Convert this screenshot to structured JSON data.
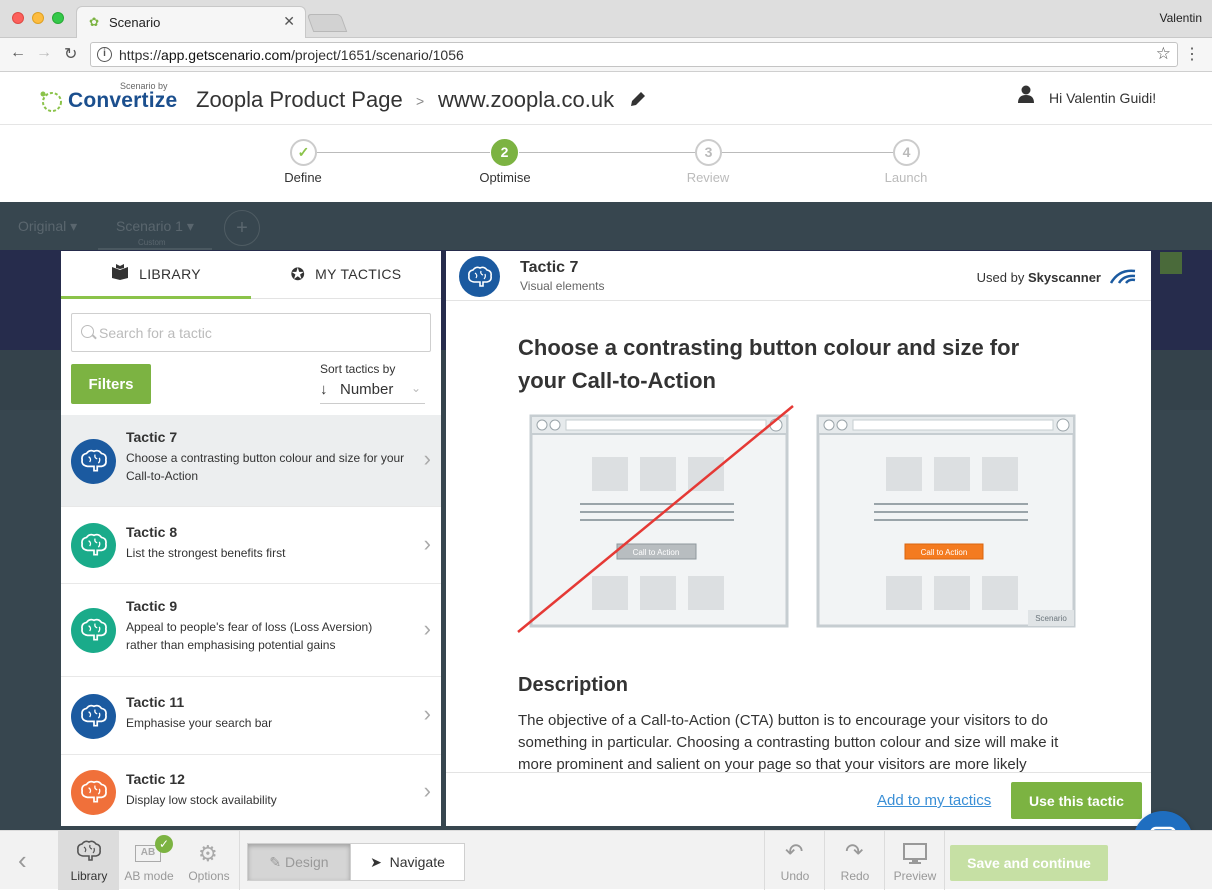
{
  "browser": {
    "tab_title": "Scenario",
    "profile_name": "Valentin",
    "url_prefix": "https://",
    "url_host": "app.getscenario.com",
    "url_path": "/project/1651/scenario/1056"
  },
  "app_header": {
    "logo_sub": "Scenario by",
    "logo_main": "Convertize",
    "project_name": "Zoopla Product Page",
    "crumb_separator": ">",
    "project_url": "www.zoopla.co.uk",
    "greeting": "Hi Valentin Guidi!"
  },
  "stepper": {
    "steps": [
      {
        "number": "✓",
        "label": "Define",
        "state": "done"
      },
      {
        "number": "2",
        "label": "Optimise",
        "state": "active"
      },
      {
        "number": "3",
        "label": "Review",
        "state": "upcoming"
      },
      {
        "number": "4",
        "label": "Launch",
        "state": "upcoming"
      }
    ]
  },
  "workspace": {
    "tab_original": "Original",
    "tab_scenario": "Scenario 1",
    "tab_scenario_sub": "Custom",
    "add_label": "+"
  },
  "library": {
    "tab_library": "LIBRARY",
    "tab_my_tactics": "MY TACTICS",
    "search_placeholder": "Search for a tactic",
    "filters_label": "Filters",
    "sort_label": "Sort tactics by",
    "sort_value": "Number",
    "tactics": [
      {
        "title": "Tactic 7",
        "desc": "Choose a contrasting button colour and size for your Call-to-Action",
        "color": "#1b5aa0"
      },
      {
        "title": "Tactic 8",
        "desc": "List the strongest benefits first",
        "color": "#1aab8a"
      },
      {
        "title": "Tactic 9",
        "desc": "Appeal to people's fear of loss (Loss Aversion) rather than emphasising potential gains",
        "color": "#1aab8a"
      },
      {
        "title": "Tactic 11",
        "desc": "Emphasise your search bar",
        "color": "#1b5aa0"
      },
      {
        "title": "Tactic 12",
        "desc": "Display low stock availability",
        "color": "#f0703a"
      }
    ]
  },
  "detail": {
    "title": "Tactic 7",
    "category": "Visual elements",
    "used_by_prefix": "Used by",
    "used_by_brand": "Skyscanner",
    "heading": "Choose a contrasting button colour and size for your Call-to-Action",
    "illustration": {
      "bad_button": "Call to Action",
      "good_button": "Call to Action",
      "watermark": "Scenario",
      "good_button_color": "#f47b20"
    },
    "description_heading": "Description",
    "description_text": "The objective of a Call-to-Action (CTA) button is to encourage your visitors to do something in particular. Choosing a contrasting button colour and size will make it more prominent and salient on your page so that your visitors are more likely",
    "add_link": "Add to my tactics",
    "use_button": "Use this tactic"
  },
  "toolbar": {
    "library_label": "Library",
    "ab_label": "AB mode",
    "options_label": "Options",
    "design_label": "Design",
    "navigate_label": "Navigate",
    "undo_label": "Undo",
    "redo_label": "Redo",
    "preview_label": "Preview",
    "save_label": "Save and continue"
  },
  "colors": {
    "accent_green": "#7cb342",
    "brand_blue": "#1b4f8e",
    "link_blue": "#3a8fd6"
  }
}
